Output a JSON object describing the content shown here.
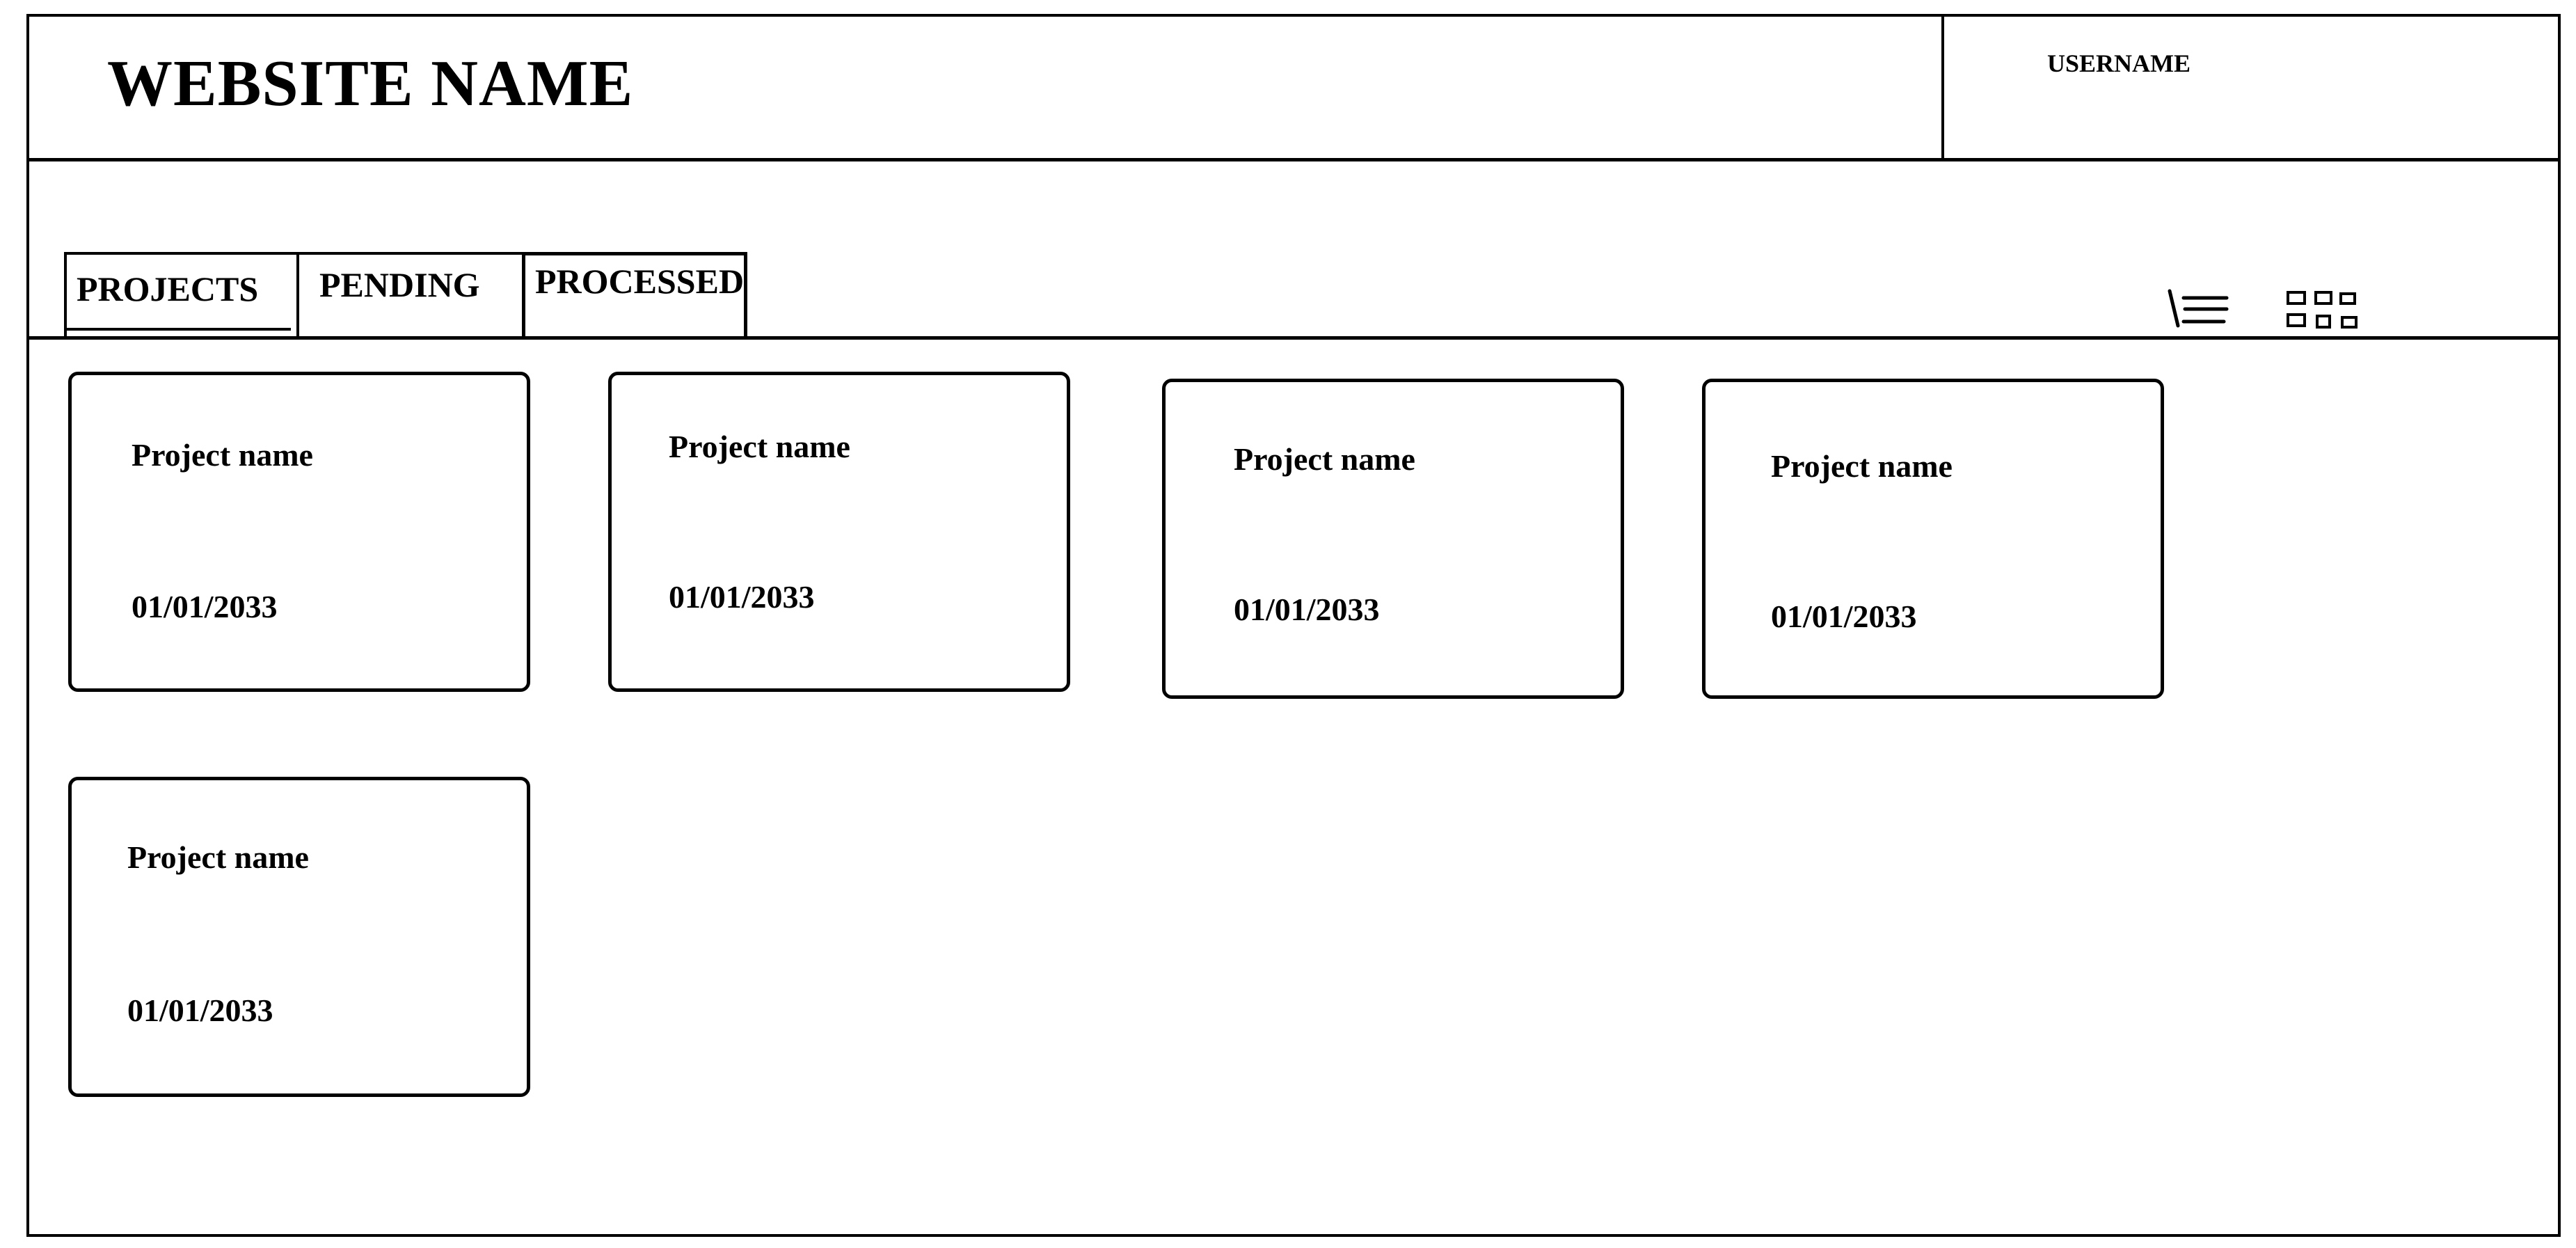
{
  "header": {
    "site_name": "WEBSITE NAME",
    "username": "USERNAME"
  },
  "tabs": [
    {
      "label": "PROJECTS",
      "active": true
    },
    {
      "label": "PENDING",
      "active": false
    },
    {
      "label": "PROCESSED",
      "active": false
    }
  ],
  "view_toggle": {
    "list_icon": "list-view-icon",
    "grid_icon": "grid-view-icon"
  },
  "cards": [
    {
      "name": "Project name",
      "date": "01/01/2033"
    },
    {
      "name": "Project name",
      "date": "01/01/2033"
    },
    {
      "name": "Project name",
      "date": "01/01/2033"
    },
    {
      "name": "Project name",
      "date": "01/01/2033"
    },
    {
      "name": "Project name",
      "date": "01/01/2033"
    }
  ]
}
